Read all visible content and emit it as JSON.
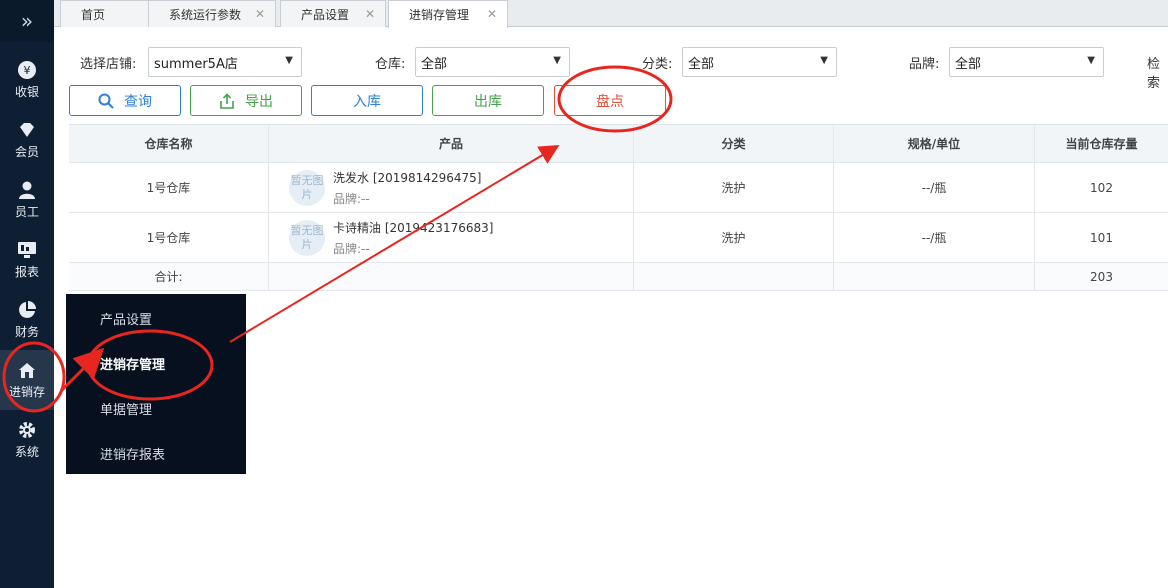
{
  "sidebar": {
    "items": [
      {
        "label": "收银",
        "icon": "cash-icon"
      },
      {
        "label": "会员",
        "icon": "diamond-icon"
      },
      {
        "label": "员工",
        "icon": "person-icon"
      },
      {
        "label": "报表",
        "icon": "monitor-icon"
      },
      {
        "label": "财务",
        "icon": "pie-icon"
      },
      {
        "label": "进销存",
        "icon": "home-icon"
      },
      {
        "label": "系统",
        "icon": "gear-icon"
      }
    ]
  },
  "tabs": [
    {
      "label": "首页"
    },
    {
      "label": "系统运行参数"
    },
    {
      "label": "产品设置"
    },
    {
      "label": "进销存管理"
    }
  ],
  "filters": {
    "store_label": "选择店铺:",
    "store_value": "summer5A店",
    "warehouse_label": "仓库:",
    "warehouse_value": "全部",
    "category_label": "分类:",
    "category_value": "全部",
    "brand_label": "品牌:",
    "brand_value": "全部",
    "search_label": "检索"
  },
  "buttons": {
    "query": "查询",
    "export": "导出",
    "stock_in": "入库",
    "stock_out": "出库",
    "inventory_check": "盘点"
  },
  "table": {
    "headers": [
      "仓库名称",
      "产品",
      "分类",
      "规格/单位",
      "当前仓库存量"
    ],
    "rows": [
      {
        "warehouse": "1号仓库",
        "product": "洗发水 [2019814296475]",
        "brand": "品牌:--",
        "category": "洗护",
        "spec": "--/瓶",
        "stock": "102"
      },
      {
        "warehouse": "1号仓库",
        "product": "卡诗精油 [2019423176683]",
        "brand": "品牌:--",
        "category": "洗护",
        "spec": "--/瓶",
        "stock": "101"
      }
    ],
    "no_image": "暂无图片",
    "total_label": "合计:",
    "total_stock": "203"
  },
  "submenu": {
    "items": [
      {
        "label": "产品设置"
      },
      {
        "label": "进销存管理"
      },
      {
        "label": "单据管理"
      },
      {
        "label": "进销存报表"
      }
    ]
  },
  "colors": {
    "sidebar": "#0f1f33",
    "accent_blue": "#2e7fd6",
    "accent_green": "#46a34a",
    "accent_red": "#e0523a",
    "annotation_red": "#e8261f"
  }
}
